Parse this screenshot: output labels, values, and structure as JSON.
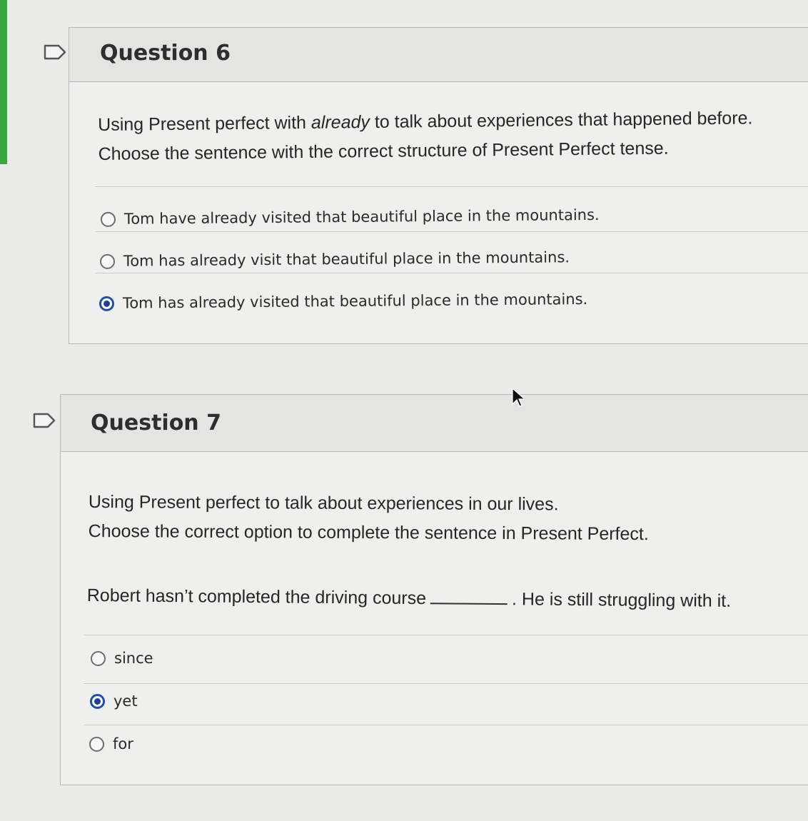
{
  "colors": {
    "selected_radio": "#1d3f99",
    "card_header": "#e4e4e3",
    "sidebar_accent": "#3aa640"
  },
  "question6": {
    "title": "Question 6",
    "stem_line1_before": "Using Present perfect with ",
    "stem_line1_italic": "already",
    "stem_line1_after": " to talk about experiences that happened before.",
    "stem_line2": "Choose the sentence with the correct structure of Present Perfect tense.",
    "options": [
      {
        "label": "Tom have already visited that beautiful place in the mountains.",
        "selected": false
      },
      {
        "label": "Tom has already visit that beautiful place in the mountains.",
        "selected": false
      },
      {
        "label": "Tom has already visited that beautiful place in the mountains.",
        "selected": true
      }
    ]
  },
  "question7": {
    "title": "Question 7",
    "stem_line1": "Using Present perfect to talk about experiences in our lives.",
    "stem_line2": "Choose the correct option to complete the sentence in Present Perfect.",
    "sentence_before": "Robert hasn’t completed the driving course",
    "sentence_after": ". He is still struggling with it.",
    "options": [
      {
        "label": "since",
        "selected": false
      },
      {
        "label": "yet",
        "selected": true
      },
      {
        "label": "for",
        "selected": false
      }
    ]
  }
}
